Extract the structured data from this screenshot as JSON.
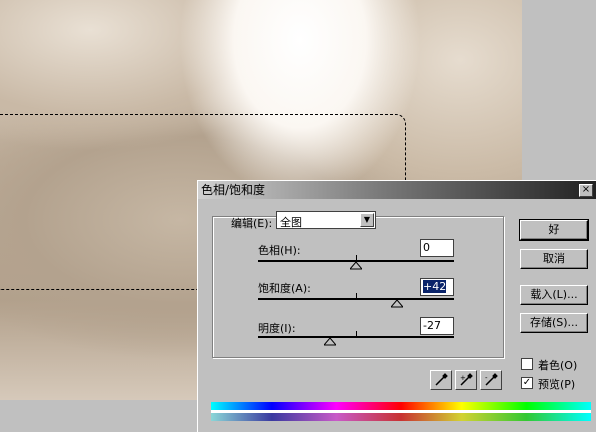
{
  "dialog": {
    "title": "色相/饱和度",
    "close_glyph": "×",
    "edit": {
      "label": "编辑(E):",
      "value": "全图",
      "arrow": "▼"
    },
    "sliders": [
      {
        "label": "色相(H):",
        "value": "0",
        "min": -180,
        "max": 180,
        "level": 0
      },
      {
        "label": "饱和度(A):",
        "value": "+42",
        "min": -100,
        "max": 100,
        "level": 42
      },
      {
        "label": "明度(I):",
        "value": "-27",
        "min": -100,
        "max": 100,
        "level": -27
      }
    ],
    "buttons": {
      "ok": "好",
      "cancel": "取消",
      "load": "载入(L)...",
      "save": "存储(S)..."
    },
    "checkboxes": {
      "colorize": {
        "label": "着色(O)",
        "checked": false
      },
      "preview": {
        "label": "预览(P)",
        "checked": true,
        "mark": "✓"
      }
    },
    "eyedroppers": [
      "eyedropper-icon",
      "eyedropper-plus-icon",
      "eyedropper-minus-icon"
    ]
  }
}
